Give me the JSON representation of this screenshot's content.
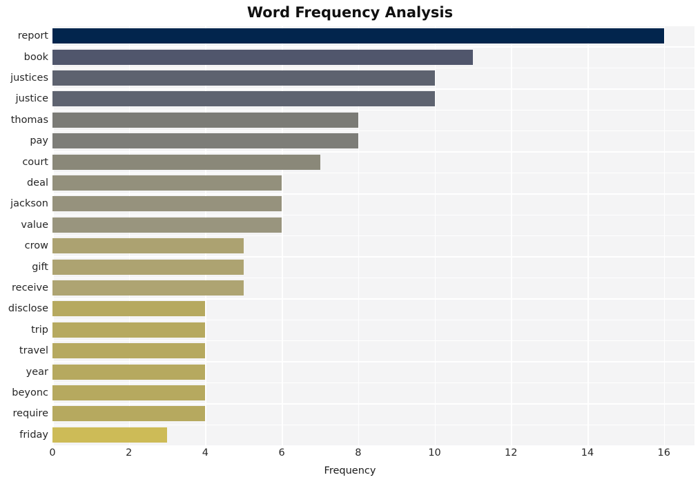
{
  "chart_data": {
    "type": "bar",
    "orientation": "horizontal",
    "title": "Word Frequency Analysis",
    "xlabel": "Frequency",
    "ylabel": "",
    "categories": [
      "report",
      "book",
      "justices",
      "justice",
      "thomas",
      "pay",
      "court",
      "deal",
      "jackson",
      "value",
      "crow",
      "gift",
      "receive",
      "disclose",
      "trip",
      "travel",
      "year",
      "beyonc",
      "require",
      "friday"
    ],
    "values": [
      16,
      11,
      10,
      10,
      8,
      8,
      7,
      6,
      6,
      6,
      5,
      5,
      5,
      4,
      4,
      4,
      4,
      4,
      4,
      3
    ],
    "xlim": [
      0,
      16.8
    ],
    "xticks": [
      0,
      2,
      4,
      6,
      8,
      10,
      12,
      14,
      16
    ],
    "xtick_labels": [
      "0",
      "2",
      "4",
      "6",
      "8",
      "10",
      "12",
      "14",
      "16"
    ],
    "grid": true,
    "legend": null,
    "bar_colors": [
      "#02254d",
      "#50566c",
      "#5d626f",
      "#5e6370",
      "#7b7b76",
      "#7d7d78",
      "#8a8879",
      "#93907c",
      "#96927d",
      "#99957e",
      "#aca271",
      "#ada371",
      "#aea472",
      "#b6a95f",
      "#b6a95f",
      "#b6a95f",
      "#b6a95f",
      "#b6a95f",
      "#b6a95f",
      "#cdbb57"
    ],
    "palette_name": "cividis-like",
    "plot_background": "#f4f4f5",
    "grid_color": "#ffffff",
    "text_color": "#262626"
  }
}
